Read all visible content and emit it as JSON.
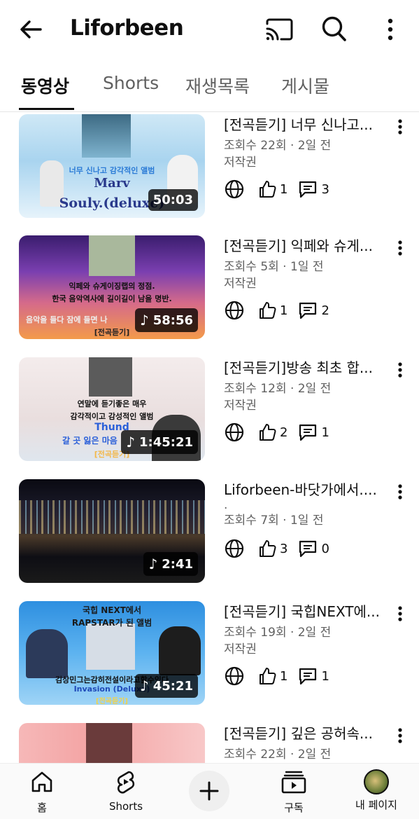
{
  "header": {
    "title": "Liforbeen"
  },
  "tabs": [
    {
      "label": "동영상",
      "active": true
    },
    {
      "label": "Shorts",
      "active": false
    },
    {
      "label": "재생목록",
      "active": false
    },
    {
      "label": "게시물",
      "active": false
    }
  ],
  "videos": [
    {
      "title": "[전곡듣기] 너무 신나고...",
      "meta": "조회수 22회 · 2일 전",
      "extra": "저작권",
      "duration": "50:03",
      "music": false,
      "likes": "1",
      "comments": "3",
      "thumb_text": [
        "너무 신나고 감각적인 앨범",
        "Marv",
        "Souly.(deluxe)"
      ]
    },
    {
      "title": "[전곡듣기] 익페와 슈게...",
      "meta": "조회수 5회 · 1일 전",
      "extra": "저작권",
      "duration": "58:56",
      "music": true,
      "likes": "1",
      "comments": "2",
      "thumb_text": [
        "익페와 슈게이징랩의 정점.",
        "한국 음악역사에 길이길이 남을 명반.",
        "음악을 들다 잠에 들면 나",
        "[전곡듣기]"
      ]
    },
    {
      "title": "[전곡듣기]방송 최초 합...",
      "meta": "조회수 12회 · 2일 전",
      "extra": "저작권",
      "duration": "1:45:21",
      "music": true,
      "likes": "2",
      "comments": "1",
      "thumb_text": [
        "연말에 듣기좋은 매우",
        "감각적이고 감성적인 앨범",
        "Thund",
        "갈 곳 잃은 마음",
        "[전곡듣기]"
      ]
    },
    {
      "title": "Liforbeen-바닷가에서....",
      "meta": "조회수 7회 · 1일 전",
      "extra": ".",
      "duration": "2:41",
      "music": true,
      "likes": "3",
      "comments": "0",
      "thumb_text": []
    },
    {
      "title": "[전곡듣기] 국힙NEXT에...",
      "meta": "조회수 19회 · 2일 전",
      "extra": "저작권",
      "duration": "45:21",
      "music": true,
      "likes": "1",
      "comments": "1",
      "thumb_text": [
        "국힙 NEXT에서",
        "RAPSTAR가 된 앨범",
        "김상민그는감히전설이라고할수있다",
        "Invasion (Deluxe)",
        "[전곡듣기]"
      ]
    },
    {
      "title": "[전곡듣기] 깊은 공허속...",
      "meta": "조회수 22회 · 2일 전",
      "extra": "",
      "duration": "",
      "music": false,
      "likes": "",
      "comments": "",
      "thumb_text": []
    }
  ],
  "bottom_nav": {
    "home": "홈",
    "shorts": "Shorts",
    "subscriptions": "구독",
    "you": "내 페이지"
  }
}
